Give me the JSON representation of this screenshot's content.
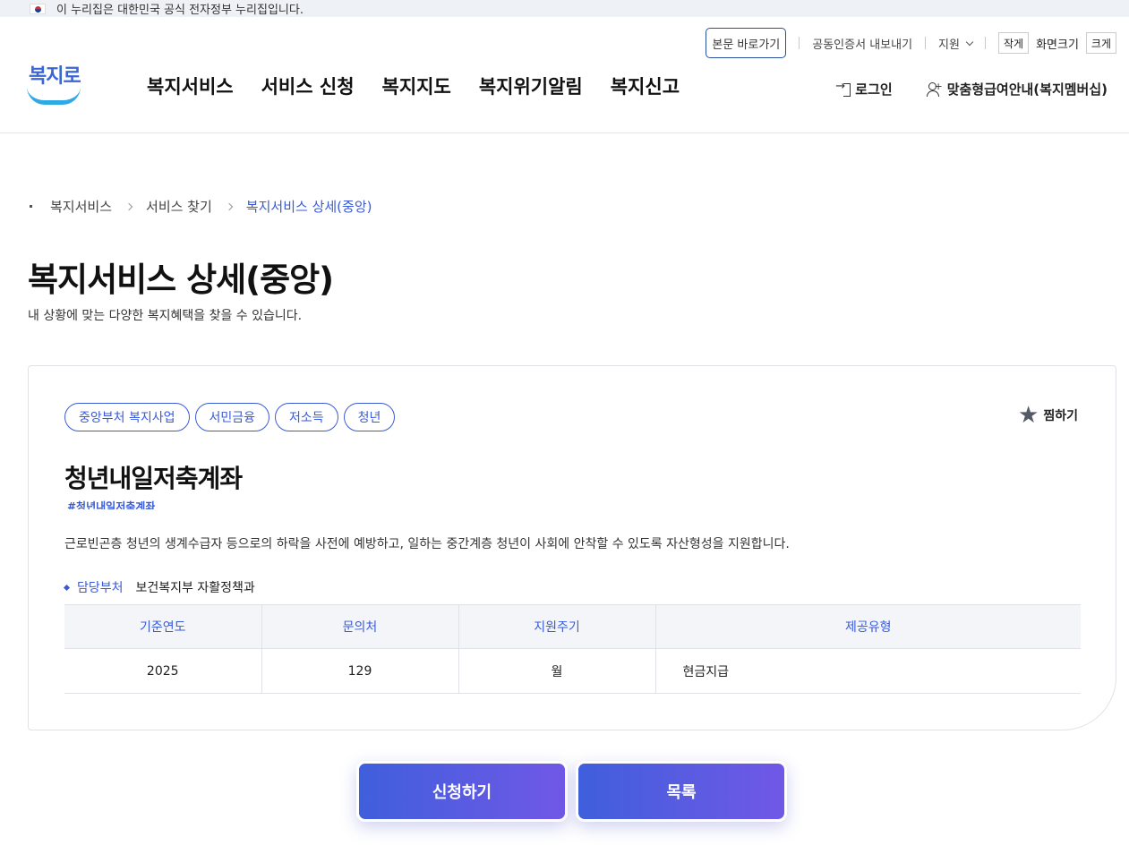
{
  "gov_banner": {
    "text": "이 누리집은 대한민국 공식 전자정부 누리집입니다."
  },
  "util": {
    "skip": "본문 바로가기",
    "cert": "공동인증서 내보내기",
    "support": "지원",
    "small": "작게",
    "screen_size": "화면크기",
    "large": "크게"
  },
  "logo": {
    "text": "복지로"
  },
  "gnb": [
    "복지서비스",
    "서비스 신청",
    "복지지도",
    "복지위기알림",
    "복지신고"
  ],
  "member": {
    "login": "로그인",
    "membership": "맞춤형급여안내(복지멤버십)"
  },
  "breadcrumb": [
    "복지서비스",
    "서비스 찾기",
    "복지서비스 상세(중앙)"
  ],
  "page": {
    "title": "복지서비스 상세(중앙)",
    "description": "내 상황에 맞는 다양한 복지혜택을 찾을 수 있습니다."
  },
  "service": {
    "tags": [
      "중앙부처 복지사업",
      "서민금융",
      "저소득",
      "청년"
    ],
    "favorite": "찜하기",
    "title": "청년내일저축계좌",
    "hashtag": "#청년내일저축계좌",
    "description": "근로빈곤층 청년의 생계수급자 등으로의 하락을 사전에 예방하고, 일하는 중간계층 청년이 사회에 안착할 수 있도록 자산형성을 지원합니다.",
    "dept_label": "담당부처",
    "dept_value": "보건복지부 자활정책과",
    "table": {
      "headers": [
        "기준연도",
        "문의처",
        "지원주기",
        "제공유형"
      ],
      "row": [
        "2025",
        "129",
        "월",
        "현금지급"
      ]
    }
  },
  "buttons": {
    "apply": "신청하기",
    "list": "목록"
  }
}
